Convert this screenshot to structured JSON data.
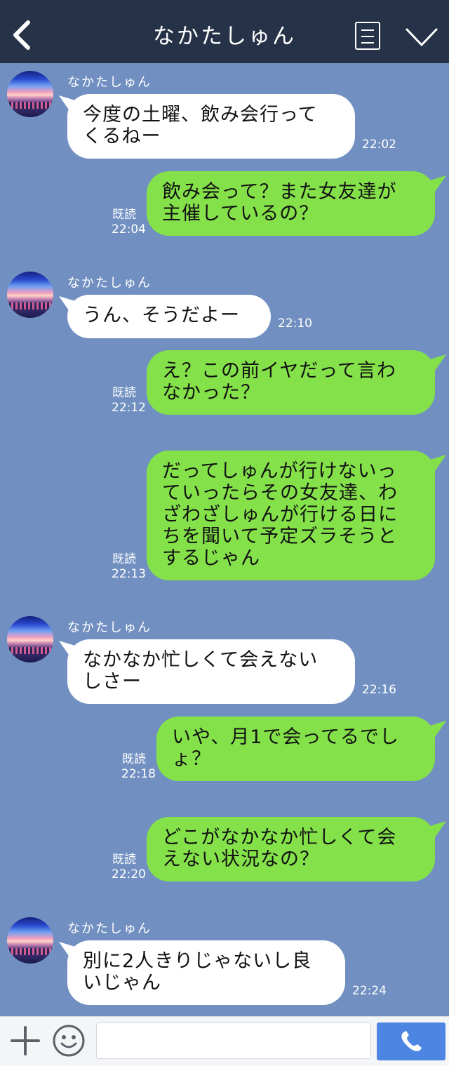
{
  "header": {
    "title": "なかたしゅん",
    "back_icon": "back-chevron-icon",
    "menu_icon": "menu-list-icon",
    "dropdown_icon": "chevron-down-icon"
  },
  "messages": [
    {
      "side": "in",
      "sender": "なかたしゅん",
      "text": "今度の土曜、飲み会行って\nくるねー",
      "time": "22:02"
    },
    {
      "side": "out",
      "text": "飲み会って？また女友達が\n主催しているの？",
      "read": "既読",
      "time": "22:04"
    },
    {
      "side": "in",
      "sender": "なかたしゅん",
      "text": "うん、そうだよー",
      "time": "22:10"
    },
    {
      "side": "out",
      "text": "え？この前イヤだって言わ\nなかった？",
      "read": "既読",
      "time": "22:12"
    },
    {
      "side": "out",
      "text": "だってしゅんが行けないっ\nていったらその女友達、わ\nざわざしゅんが行ける日に\nちを聞いて予定ズラそうと\nするじゃん",
      "read": "既読",
      "time": "22:13"
    },
    {
      "side": "in",
      "sender": "なかたしゅん",
      "text": "なかなか忙しくて会えない\nしさー",
      "time": "22:16"
    },
    {
      "side": "out",
      "text": "いや、月1で会ってるでし\nょ？",
      "read": "既読",
      "time": "22:18"
    },
    {
      "side": "out",
      "text": "どこがなかなか忙しくて会\nえない状況なの？",
      "read": "既読",
      "time": "22:20"
    },
    {
      "side": "in",
      "sender": "なかたしゅん",
      "text": "別に2人きりじゃないし良\nいじゃん",
      "time": "22:24"
    }
  ],
  "footer": {
    "input_value": "",
    "input_placeholder": "",
    "plus_icon": "plus-icon",
    "emoji_icon": "smiley-icon",
    "call_icon": "phone-icon"
  },
  "colors": {
    "background": "#7190c1",
    "header": "#263248",
    "outgoing": "#84e14a",
    "incoming": "#ffffff",
    "call_button": "#4c86e2"
  }
}
